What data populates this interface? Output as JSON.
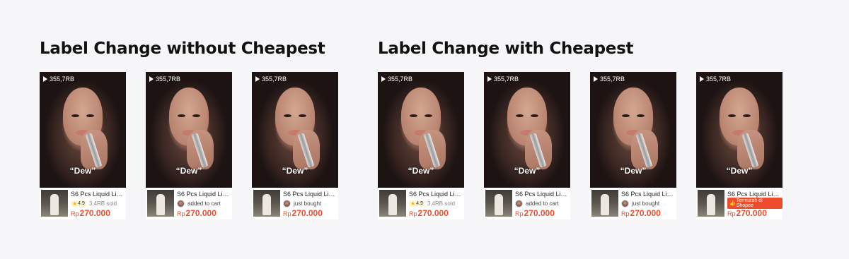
{
  "sections": [
    {
      "title": "Label Change without Cheapest"
    },
    {
      "title": "Label Change with Cheapest"
    }
  ],
  "cards": [
    {
      "views": "355,7RB",
      "caption": "“Dew”",
      "product": "S6 Pcs Liquid Lip...",
      "label_type": "rating",
      "rating": "4.9",
      "sold": "3,4RB sold",
      "currency": "Rp",
      "price": "270.000"
    },
    {
      "views": "355,7RB",
      "caption": "“Dew”",
      "product": "S6 Pcs Liquid Lip...",
      "label_type": "activity",
      "activity": "added to cart",
      "currency": "Rp",
      "price": "270.000"
    },
    {
      "views": "355,7RB",
      "caption": "“Dew”",
      "product": "S6 Pcs Liquid Lip...",
      "label_type": "activity",
      "activity": "just bought",
      "currency": "Rp",
      "price": "270.000"
    },
    {
      "views": "355,7RB",
      "caption": "“Dew”",
      "product": "S6 Pcs Liquid Lip...",
      "label_type": "rating",
      "rating": "4.9",
      "sold": "3,4RB sold",
      "currency": "Rp",
      "price": "270.000"
    },
    {
      "views": "355,7RB",
      "caption": "“Dew”",
      "product": "S6 Pcs Liquid Lip...",
      "label_type": "activity",
      "activity": "added to cart",
      "currency": "Rp",
      "price": "270.000"
    },
    {
      "views": "355,7RB",
      "caption": "“Dew”",
      "product": "S6 Pcs Liquid Lip...",
      "label_type": "activity",
      "activity": "just bought",
      "currency": "Rp",
      "price": "270.000"
    },
    {
      "views": "355,7RB",
      "caption": "“Dew”",
      "product": "S6 Pcs Liquid Lip...",
      "label_type": "badge",
      "badge": "Termurah di Shopee",
      "currency": "Rp",
      "price": "270.000"
    }
  ],
  "colors": {
    "price": "#ee4d2d",
    "badge": "#ee4d2d",
    "star": "#f6b40a"
  }
}
